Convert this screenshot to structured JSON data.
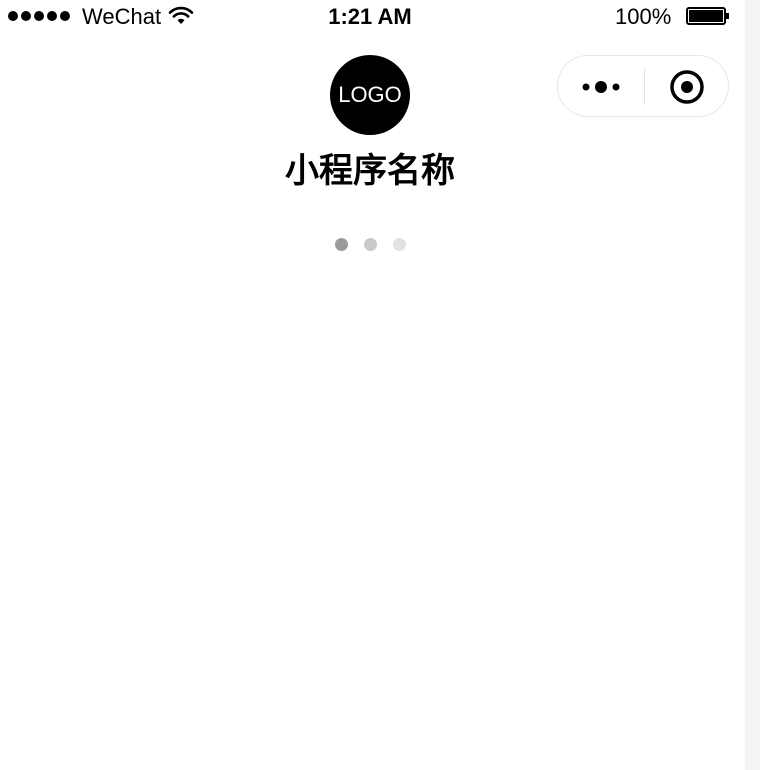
{
  "status_bar": {
    "carrier": "WeChat",
    "time": "1:21 AM",
    "battery_percent": "100%",
    "icons": [
      "signal-dots-icon",
      "wifi-icon",
      "battery-icon"
    ]
  },
  "capsule": {
    "more_icon": "more-dots-icon",
    "close_icon": "target-close-icon"
  },
  "splash": {
    "logo_text": "LOGO",
    "app_name": "小程序名称",
    "loading_dots": [
      {
        "color": "#9b9b9b"
      },
      {
        "color": "#c9c9c9"
      },
      {
        "color": "#e2e2e2"
      }
    ]
  }
}
